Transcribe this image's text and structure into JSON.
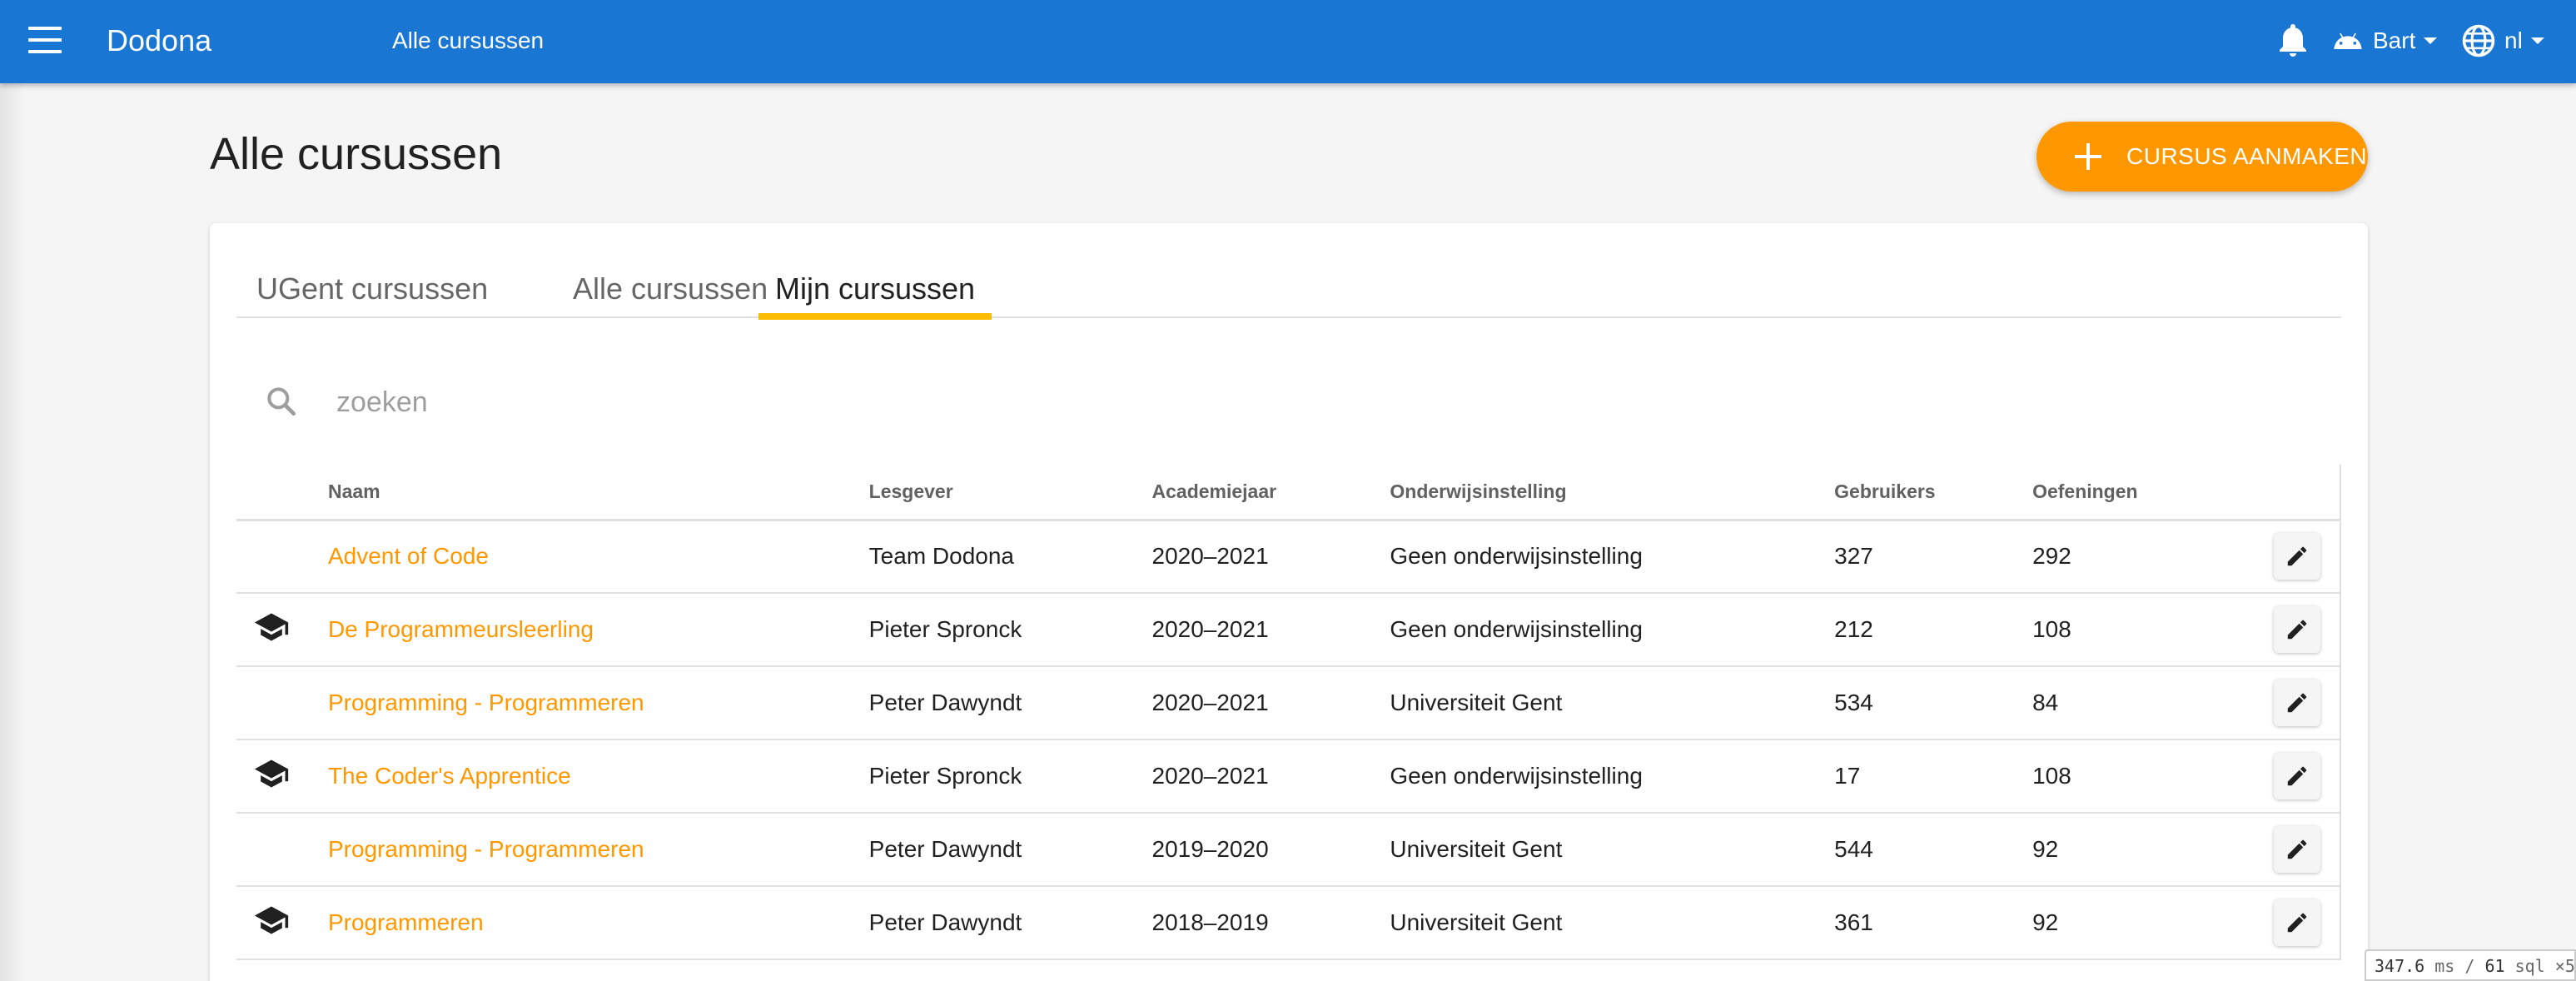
{
  "appbar": {
    "brand": "Dodona",
    "title": "Alle cursussen",
    "user_label": "Bart",
    "lang_label": "nl",
    "color": "#1976d2"
  },
  "page": {
    "title": "Alle cursussen",
    "create_button": "CURSUS AANMAKEN",
    "accent": "#ff9800"
  },
  "tabs": [
    {
      "label": "UGent cursussen",
      "active": false
    },
    {
      "label": "Alle cursussen",
      "active": false
    },
    {
      "label": "Mijn cursussen",
      "active": true
    }
  ],
  "search": {
    "placeholder": "zoeken",
    "value": ""
  },
  "table": {
    "headers": [
      "Naam",
      "Lesgever",
      "Academiejaar",
      "Onderwijsinstelling",
      "Gebruikers",
      "Oefeningen"
    ],
    "rows": [
      {
        "icon": "",
        "name": "Advent of Code",
        "teacher": "Team Dodona",
        "year": "2020–2021",
        "institution": "Geen onderwijsinstelling",
        "users": "327",
        "exercises": "292"
      },
      {
        "icon": "graduation-cap-icon",
        "name": "De Programmeursleerling",
        "teacher": "Pieter Spronck",
        "year": "2020–2021",
        "institution": "Geen onderwijsinstelling",
        "users": "212",
        "exercises": "108"
      },
      {
        "icon": "",
        "name": "Programming - Programmeren",
        "teacher": "Peter Dawyndt",
        "year": "2020–2021",
        "institution": "Universiteit Gent",
        "users": "534",
        "exercises": "84"
      },
      {
        "icon": "graduation-cap-icon",
        "name": "The Coder's Apprentice",
        "teacher": "Pieter Spronck",
        "year": "2020–2021",
        "institution": "Geen onderwijsinstelling",
        "users": "17",
        "exercises": "108"
      },
      {
        "icon": "",
        "name": "Programming - Programmeren",
        "teacher": "Peter Dawyndt",
        "year": "2019–2020",
        "institution": "Universiteit Gent",
        "users": "544",
        "exercises": "92"
      },
      {
        "icon": "graduation-cap-icon",
        "name": "Programmeren",
        "teacher": "Peter Dawyndt",
        "year": "2018–2019",
        "institution": "Universiteit Gent",
        "users": "361",
        "exercises": "92"
      }
    ]
  },
  "perf": {
    "ms": "347.6",
    "ms_unit": "ms",
    "sql": "61",
    "sql_unit": "sql",
    "mult": "×5"
  }
}
